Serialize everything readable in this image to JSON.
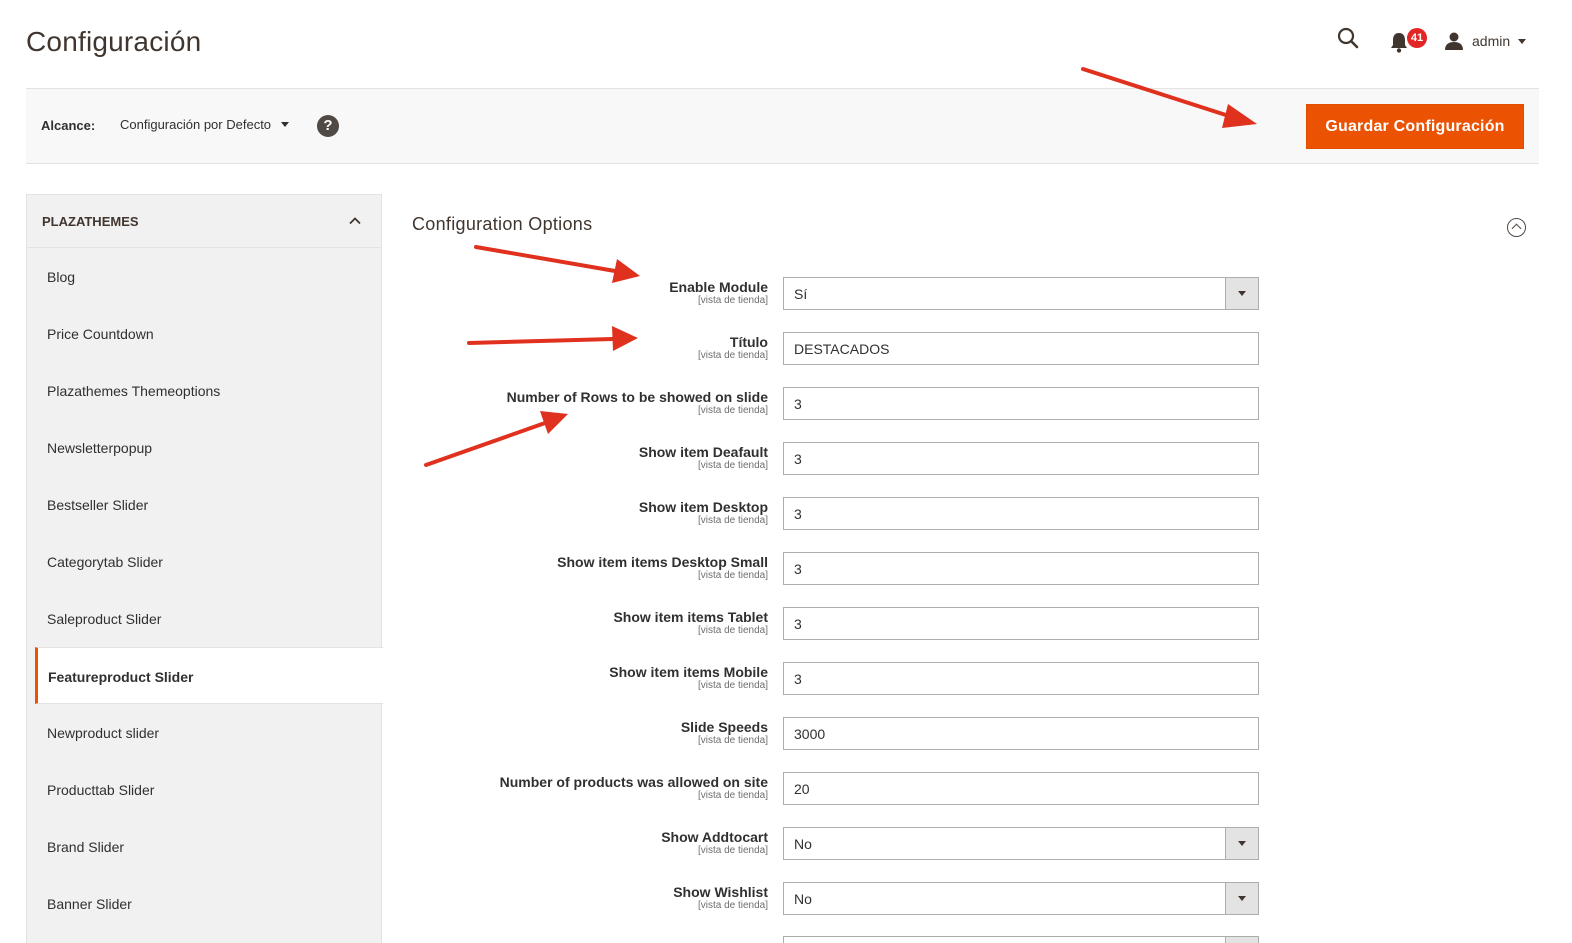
{
  "header": {
    "title": "Configuración",
    "notifications_count": "41",
    "user_name": "admin"
  },
  "scope": {
    "label": "Alcance:",
    "value": "Configuración por Defecto",
    "help": "?"
  },
  "toolbar": {
    "save_label": "Guardar Configuración"
  },
  "sidebar": {
    "group_label": "PLAZATHEMES",
    "items": [
      {
        "label": "Blog"
      },
      {
        "label": "Price Countdown"
      },
      {
        "label": "Plazathemes Themeoptions"
      },
      {
        "label": "Newsletterpopup"
      },
      {
        "label": "Bestseller Slider"
      },
      {
        "label": "Categorytab Slider"
      },
      {
        "label": "Saleproduct Slider"
      },
      {
        "label": "Featureproduct Slider",
        "active": true
      },
      {
        "label": "Newproduct slider"
      },
      {
        "label": "Producttab Slider"
      },
      {
        "label": "Brand Slider"
      },
      {
        "label": "Banner Slider"
      }
    ]
  },
  "section": {
    "title": "Configuration Options"
  },
  "fields": [
    {
      "label": "Enable Module",
      "scope": "[vista de tienda]",
      "type": "select",
      "value": "Sí"
    },
    {
      "label": "Título",
      "scope": "[vista de tienda]",
      "type": "text",
      "value": "DESTACADOS"
    },
    {
      "label": "Number of Rows to be showed on slide",
      "scope": "[vista de tienda]",
      "type": "text",
      "value": "3"
    },
    {
      "label": "Show item Deafault",
      "scope": "[vista de tienda]",
      "type": "text",
      "value": "3"
    },
    {
      "label": "Show item Desktop",
      "scope": "[vista de tienda]",
      "type": "text",
      "value": "3"
    },
    {
      "label": "Show item items Desktop Small",
      "scope": "[vista de tienda]",
      "type": "text",
      "value": "3"
    },
    {
      "label": "Show item items Tablet",
      "scope": "[vista de tienda]",
      "type": "text",
      "value": "3"
    },
    {
      "label": "Show item items Mobile",
      "scope": "[vista de tienda]",
      "type": "text",
      "value": "3"
    },
    {
      "label": "Slide Speeds",
      "scope": "[vista de tienda]",
      "type": "text",
      "value": "3000"
    },
    {
      "label": "Number of products was allowed on site",
      "scope": "[vista de tienda]",
      "type": "text",
      "value": "20"
    },
    {
      "label": "Show Addtocart",
      "scope": "[vista de tienda]",
      "type": "select",
      "value": "No"
    },
    {
      "label": "Show Wishlist",
      "scope": "[vista de tienda]",
      "type": "select",
      "value": "No"
    }
  ],
  "colors": {
    "accent": "#eb5202",
    "annotation_arrow": "#e0301e",
    "badge": "#e22626"
  }
}
